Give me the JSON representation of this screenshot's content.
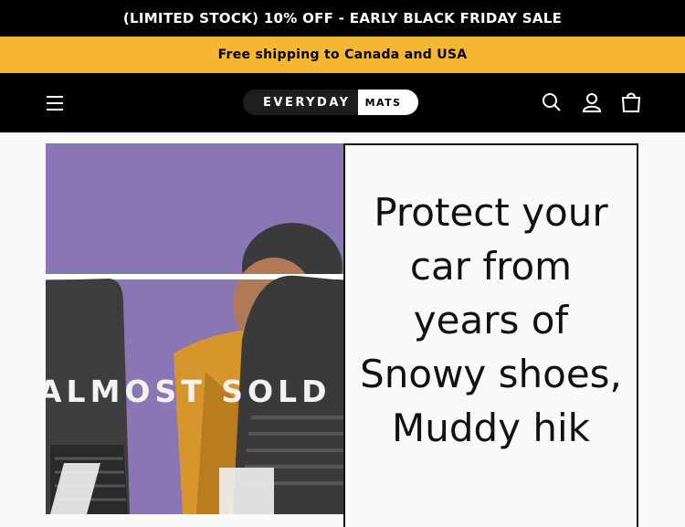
{
  "announcement": {
    "text": "(LIMITED STOCK) 10% OFF - EARLY BLACK FRIDAY SALE"
  },
  "shipping_bar": {
    "text": "Free shipping to Canada and USA"
  },
  "header": {
    "logo_left": "EVERYDAY",
    "logo_right": "MATS",
    "icons": [
      "menu-icon",
      "search-icon",
      "account-icon",
      "cart-icon"
    ]
  },
  "hero": {
    "overlay_text": "ALMOST SOLD O",
    "headline": "Protect your car from years of Snowy shoes, Muddy hik"
  },
  "colors": {
    "announcement_bg": "#000000",
    "shipping_bg": "#f5b731",
    "header_bg": "#000000",
    "photo_bg": "#8a76b4"
  }
}
